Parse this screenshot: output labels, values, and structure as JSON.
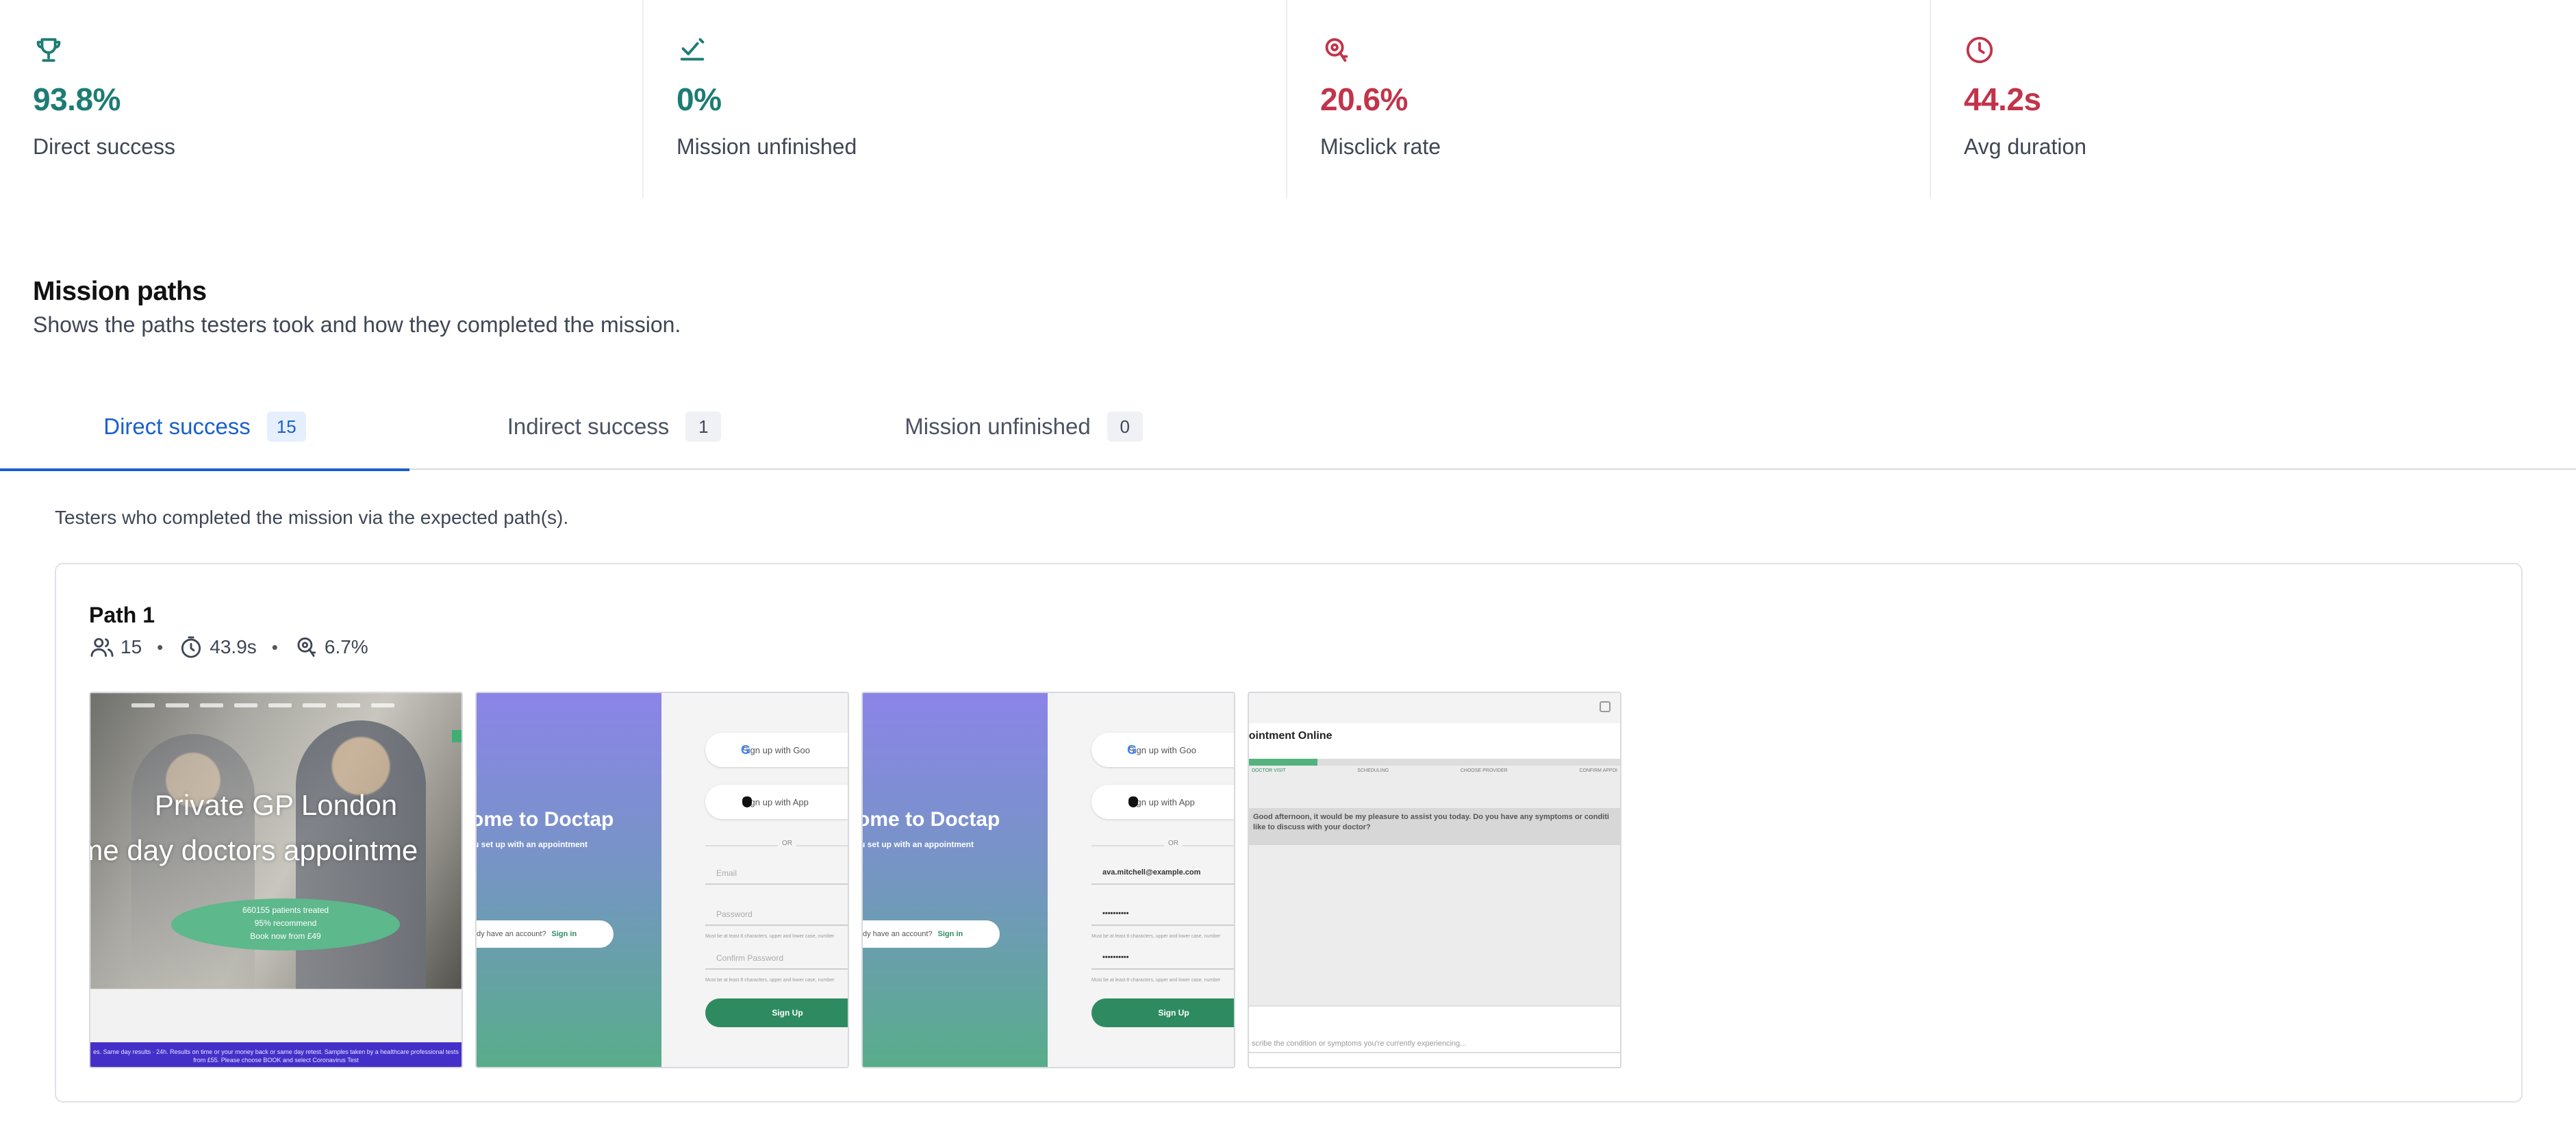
{
  "stats": [
    {
      "icon": "trophy-icon",
      "value": "93.8%",
      "label": "Direct success",
      "color": "#1c7c74"
    },
    {
      "icon": "mission-unfinished-icon",
      "value": "0%",
      "label": "Mission unfinished",
      "color": "#1c7c74"
    },
    {
      "icon": "misclick-target-icon",
      "value": "20.6%",
      "label": "Misclick rate",
      "color": "#c1344a"
    },
    {
      "icon": "clock-icon",
      "value": "44.2s",
      "label": "Avg duration",
      "color": "#c1344a"
    }
  ],
  "section": {
    "title": "Mission paths",
    "subtitle": "Shows the paths testers took and how they completed the mission."
  },
  "tabs": [
    {
      "label": "Direct success",
      "count": "15",
      "active": true
    },
    {
      "label": "Indirect success",
      "count": "1",
      "active": false
    },
    {
      "label": "Mission unfinished",
      "count": "0",
      "active": false
    }
  ],
  "tab_note": "Testers who completed the mission via the expected path(s).",
  "path": {
    "title": "Path 1",
    "testers": "15",
    "duration": "43.9s",
    "misclick": "6.7%",
    "screens": {
      "home": {
        "headline1": "Private GP London",
        "headline2": "ame day doctors appointme",
        "blob_lines": [
          "660155 patients treated",
          "95% recommend",
          "Book now from £49"
        ],
        "footer": "es. Same day results · 24h. Results on time or your money back or same day retest. Samples taken by a healthcare professional tests from £55. Please choose BOOK and select Coronavirus Test"
      },
      "signup_empty": {
        "welcome": "ome to Doctap",
        "welcome_sub": "u set up with an appointment",
        "account_text": "dy have an account?",
        "signin": "Sign in",
        "google": "Sign up with Goo",
        "apple": "Sign up with App",
        "or": "OR",
        "email": "Email",
        "password": "Password",
        "confirm": "Confirm Password",
        "hint": "Must be at least 8 characters, upper and lower case, number",
        "button": "Sign Up"
      },
      "signup_filled": {
        "welcome": "ome to Doctap",
        "welcome_sub": "u set up with an appointment",
        "account_text": "dy have an account?",
        "signin": "Sign in",
        "google": "Sign up with Goo",
        "apple": "Sign up with App",
        "or": "OR",
        "email": "ava.mitchell@example.com",
        "password": "••••••••••",
        "confirm": "••••••••••",
        "hint": "Must be at least 8 characters, upper and lower case, number",
        "button": "Sign Up"
      },
      "chat": {
        "title": "pointment Online",
        "steps": [
          "DOCTOR VISIT",
          "SCHEDULING",
          "CHOOSE PROVIDER",
          "CONFIRM APPOI"
        ],
        "message": "Good afternoon, it would be my pleasure to assist you today. Do you have any symptoms or conditi like to discuss with your doctor?",
        "input_placeholder": "scribe the condition or symptoms you're currently experiencing..."
      }
    }
  }
}
